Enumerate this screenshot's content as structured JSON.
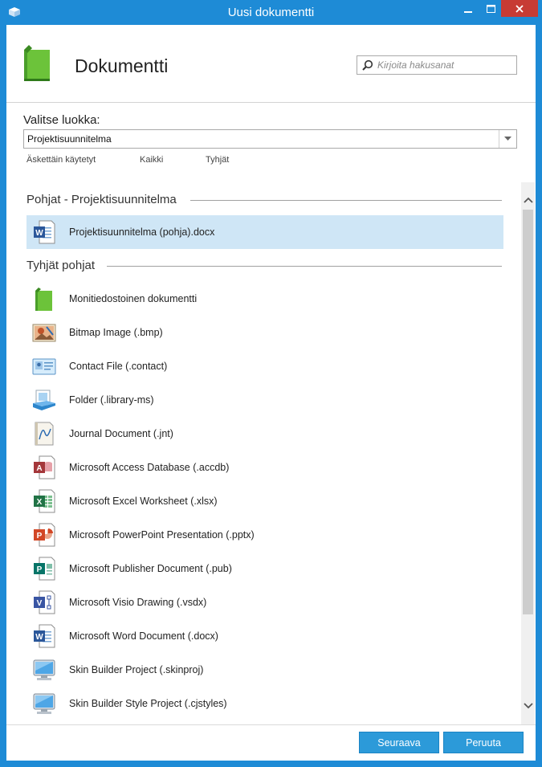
{
  "window": {
    "title": "Uusi dokumentti"
  },
  "header": {
    "title": "Dokumentti",
    "search_placeholder": "Kirjoita hakusanat"
  },
  "category": {
    "label": "Valitse luokka:",
    "selected": "Projektisuunnitelma",
    "filters": [
      "Äskettäin käytetyt",
      "Kaikki",
      "Tyhjät"
    ]
  },
  "groups": [
    {
      "title": "Pohjat - Projektisuunnitelma",
      "items": [
        {
          "label": "Projektisuunnitelma (pohja).docx",
          "icon": "word-icon",
          "selected": true
        }
      ]
    },
    {
      "title": "Tyhjät pohjat",
      "items": [
        {
          "label": "Monitiedostoinen dokumentti",
          "icon": "green-book-icon"
        },
        {
          "label": "Bitmap Image (.bmp)",
          "icon": "bitmap-icon"
        },
        {
          "label": "Contact File (.contact)",
          "icon": "contact-icon"
        },
        {
          "label": "Folder (.library-ms)",
          "icon": "library-icon"
        },
        {
          "label": "Journal Document (.jnt)",
          "icon": "journal-icon"
        },
        {
          "label": "Microsoft Access Database (.accdb)",
          "icon": "access-icon"
        },
        {
          "label": "Microsoft Excel Worksheet (.xlsx)",
          "icon": "excel-icon"
        },
        {
          "label": "Microsoft PowerPoint Presentation (.pptx)",
          "icon": "powerpoint-icon"
        },
        {
          "label": "Microsoft Publisher Document (.pub)",
          "icon": "publisher-icon"
        },
        {
          "label": "Microsoft Visio Drawing (.vsdx)",
          "icon": "visio-icon"
        },
        {
          "label": "Microsoft Word Document (.docx)",
          "icon": "word-icon"
        },
        {
          "label": "Skin Builder Project (.skinproj)",
          "icon": "monitor-icon"
        },
        {
          "label": "Skin Builder Style Project (.cjstyles)",
          "icon": "monitor-icon"
        }
      ]
    }
  ],
  "footer": {
    "next_label": "Seuraava",
    "cancel_label": "Peruuta"
  },
  "colors": {
    "titlebar": "#1e8bd6",
    "close": "#c73b34",
    "selection": "#cfe6f6",
    "button": "#2c9ad9"
  }
}
